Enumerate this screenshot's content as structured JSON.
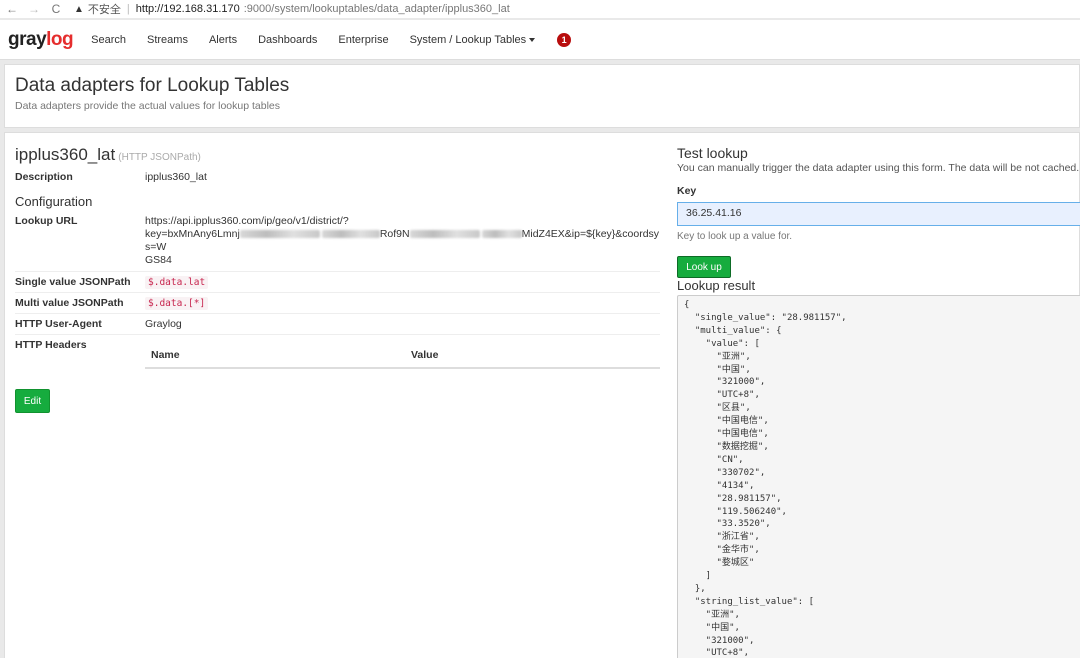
{
  "browser": {
    "back": "←",
    "forward": "→",
    "reload": "C",
    "warning": "▲",
    "insecure": "不安全",
    "separator": "|",
    "url_host": "http://192.168.31.170",
    "url_path": ":9000/system/lookuptables/data_adapter/ipplus360_lat"
  },
  "navbar": {
    "logo_gray": "gray",
    "logo_red": "log",
    "items": [
      "Search",
      "Streams",
      "Alerts",
      "Dashboards",
      "Enterprise",
      "System / Lookup Tables"
    ],
    "notification_count": "1"
  },
  "header": {
    "title": "Data adapters for Lookup Tables",
    "subtitle": "Data adapters provide the actual values for lookup tables"
  },
  "adapter": {
    "name": "ipplus360_lat",
    "type": "(HTTP JSONPath)",
    "description_label": "Description",
    "description": "ipplus360_lat",
    "config_title": "Configuration",
    "lookup_url_label": "Lookup URL",
    "lookup_url_line1": "https://api.ipplus360.com/ip/geo/v1/district/?",
    "lookup_url_line2_a": "key=bxMnAny6Lmnj",
    "lookup_url_line2_b": "Rof9N",
    "lookup_url_line2_c": "MidZ4EX&ip=${key}&coordsys=W",
    "lookup_url_line3": "GS84",
    "single_label": "Single value JSONPath",
    "single_value": "$.data.lat",
    "multi_label": "Multi value JSONPath",
    "multi_value": "$.data.[*]",
    "agent_label": "HTTP User-Agent",
    "agent_value": "Graylog",
    "headers_label": "HTTP Headers",
    "headers_name_col": "Name",
    "headers_value_col": "Value",
    "edit_label": "Edit"
  },
  "test": {
    "title": "Test lookup",
    "help": "You can manually trigger the data adapter using this form. The data will be not cached.",
    "key_label": "Key",
    "key_value": "36.25.41.16",
    "key_help": "Key to look up a value for.",
    "button": "Look up",
    "result_title": "Lookup result",
    "result_lines": [
      "{",
      "  \"single_value\": \"28.981157\",",
      "  \"multi_value\": {",
      "    \"value\": [",
      "      \"亚洲\",",
      "      \"中国\",",
      "      \"321000\",",
      "      \"UTC+8\",",
      "      \"区县\",",
      "      \"中国电信\",",
      "      \"中国电信\",",
      "      \"数据挖掘\",",
      "      \"CN\",",
      "      \"330702\",",
      "      \"4134\",",
      "      \"28.981157\",",
      "      \"119.506240\",",
      "      \"33.3520\",",
      "      \"浙江省\",",
      "      \"金华市\",",
      "      \"婺城区\"",
      "    ]",
      "  },",
      "  \"string_list_value\": [",
      "    \"亚洲\",",
      "    \"中国\",",
      "    \"321000\",",
      "    \"UTC+8\","
    ]
  }
}
